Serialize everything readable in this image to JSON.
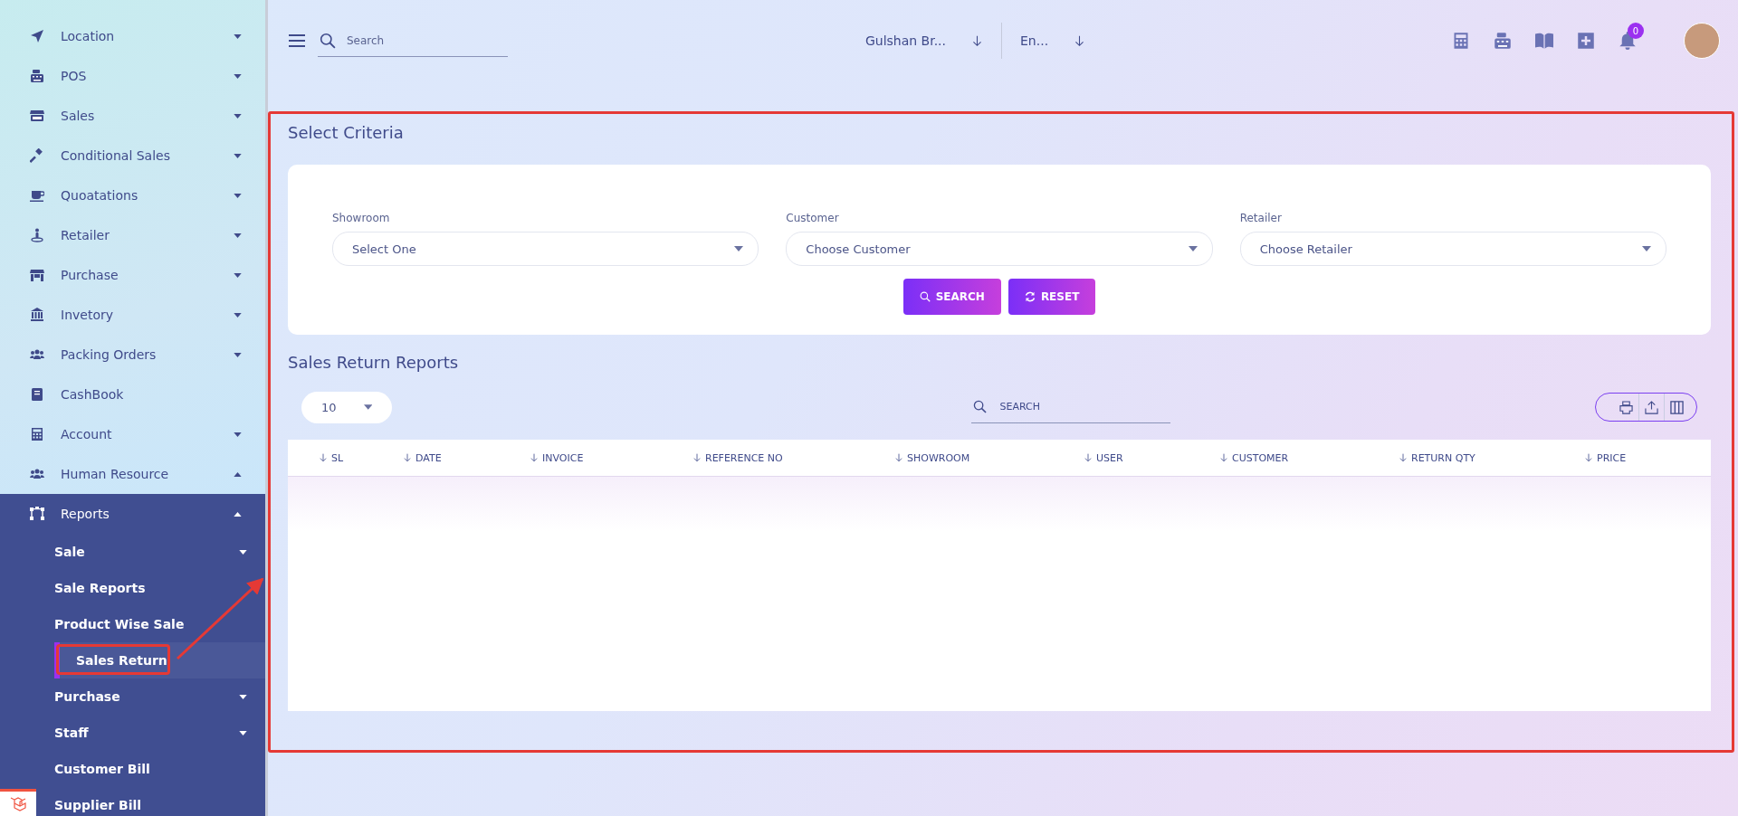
{
  "sidebar": {
    "items": [
      {
        "label": "Location",
        "kind": "group",
        "expanded": false
      },
      {
        "label": "POS",
        "kind": "group",
        "expanded": false
      },
      {
        "label": "Sales",
        "kind": "group",
        "expanded": false
      },
      {
        "label": "Conditional Sales",
        "kind": "group",
        "expanded": false
      },
      {
        "label": "Quoatations",
        "kind": "group",
        "expanded": false
      },
      {
        "label": "Retailer",
        "kind": "group",
        "expanded": false
      },
      {
        "label": "Purchase",
        "kind": "group",
        "expanded": false
      },
      {
        "label": "Invetory",
        "kind": "group",
        "expanded": false
      },
      {
        "label": "Packing Orders",
        "kind": "group",
        "expanded": false
      },
      {
        "label": "CashBook",
        "kind": "link"
      },
      {
        "label": "Account",
        "kind": "group",
        "expanded": false
      },
      {
        "label": "Human Resource",
        "kind": "group",
        "expanded": true
      },
      {
        "label": "Reports",
        "kind": "group",
        "expanded": true,
        "children": [
          {
            "label": "Sale",
            "kind": "group",
            "expanded": false,
            "selected": false
          },
          {
            "label": "Sale Reports",
            "kind": "link",
            "selected": false
          },
          {
            "label": "Product Wise Sale",
            "kind": "link",
            "selected": false
          },
          {
            "label": "Sales Return",
            "kind": "link",
            "selected": true
          },
          {
            "label": "Purchase",
            "kind": "group",
            "expanded": false,
            "selected": false
          },
          {
            "label": "Staff",
            "kind": "group",
            "expanded": false,
            "selected": false
          },
          {
            "label": "Customer Bill",
            "kind": "link",
            "selected": false
          },
          {
            "label": "Supplier Bill",
            "kind": "link",
            "selected": false
          }
        ]
      }
    ]
  },
  "header": {
    "search": {
      "placeholder": "Search"
    },
    "selects": [
      {
        "value": "Gulshan Br..."
      },
      {
        "value": "En..."
      }
    ],
    "notifications": {
      "count": "0"
    }
  },
  "criteria": {
    "title": "Select Criteria",
    "fields": [
      {
        "label": "Showroom",
        "value": "Select One"
      },
      {
        "label": "Customer",
        "value": "Choose Customer"
      },
      {
        "label": "Retailer",
        "value": "Choose Retailer"
      }
    ],
    "buttons": [
      {
        "label": "SEARCH"
      },
      {
        "label": "RESET"
      }
    ]
  },
  "report": {
    "title": "Sales Return Reports",
    "page_size": "10",
    "search": {
      "placeholder": "SEARCH"
    },
    "table": {
      "columns": [
        "SL",
        "DATE",
        "INVOICE",
        "REFERENCE NO",
        "SHOWROOM",
        "USER",
        "CUSTOMER",
        "RETURN QTY",
        "PRICE"
      ]
    }
  }
}
